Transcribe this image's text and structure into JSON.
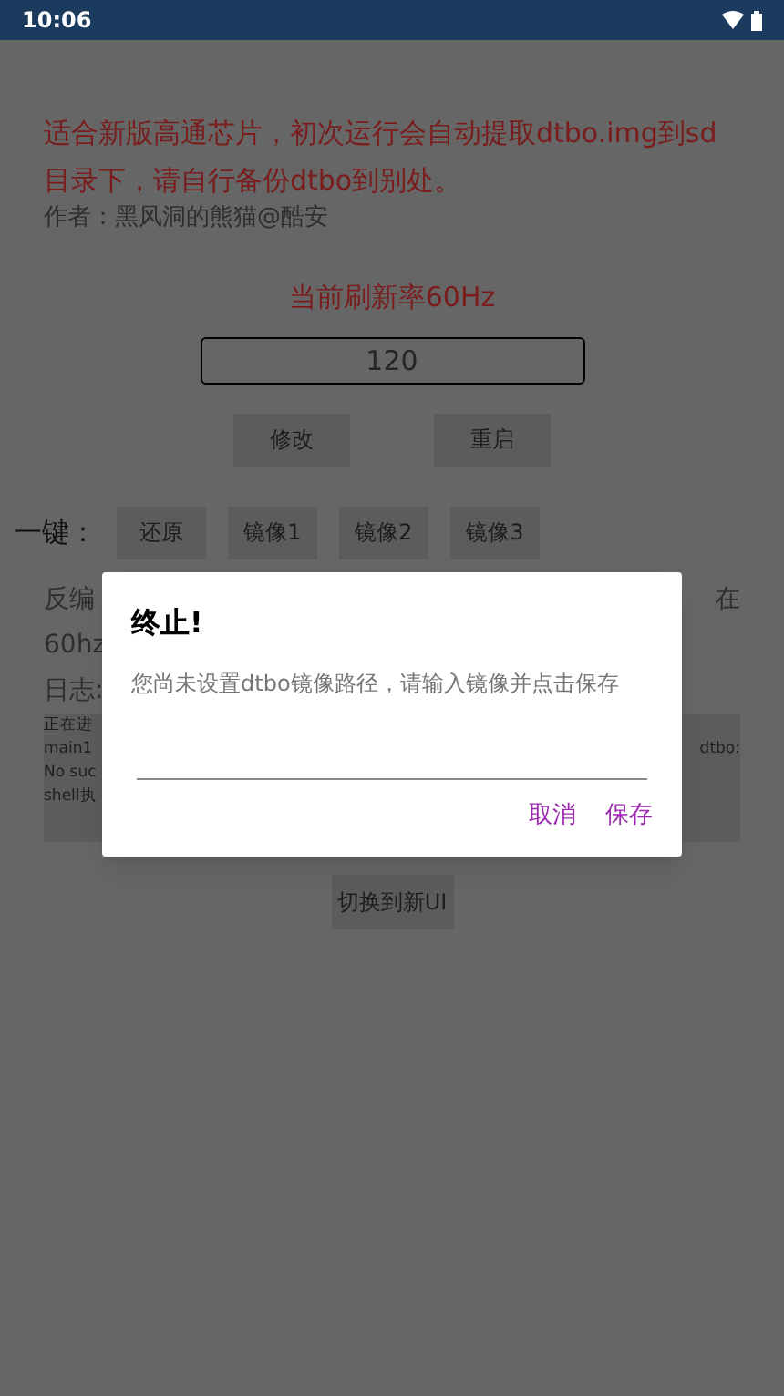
{
  "status_bar": {
    "time": "10:06"
  },
  "notice": "适合新版高通芯片，初次运行会自动提取dtbo.img到sd目录下，请自行备份dtbo到别处。",
  "author": "作者：黑风洞的熊猫@酷安",
  "refresh_rate": "当前刷新率60Hz",
  "rate_field": {
    "placeholder": "120"
  },
  "actions": [
    "修改",
    "重启"
  ],
  "one_key": {
    "label": "一键：",
    "buttons": [
      "还原",
      "镜像1",
      "镜像2",
      "镜像3"
    ]
  },
  "hint_fragments": {
    "line_1_left": "反编",
    "line_1_right": "在",
    "line_2_left": "60hz"
  },
  "log": {
    "label": "日志:",
    "lines_left": [
      "正在进",
      "main1",
      "No suc",
      "shell执"
    ],
    "line_right": "dtbo:"
  },
  "switch_button": "切换到新UI",
  "dialog": {
    "title": "终止!",
    "message": "您尚未设置dtbo镜像路径，请输入镜像并点击保存",
    "buttons": [
      "取消",
      "保存"
    ]
  }
}
